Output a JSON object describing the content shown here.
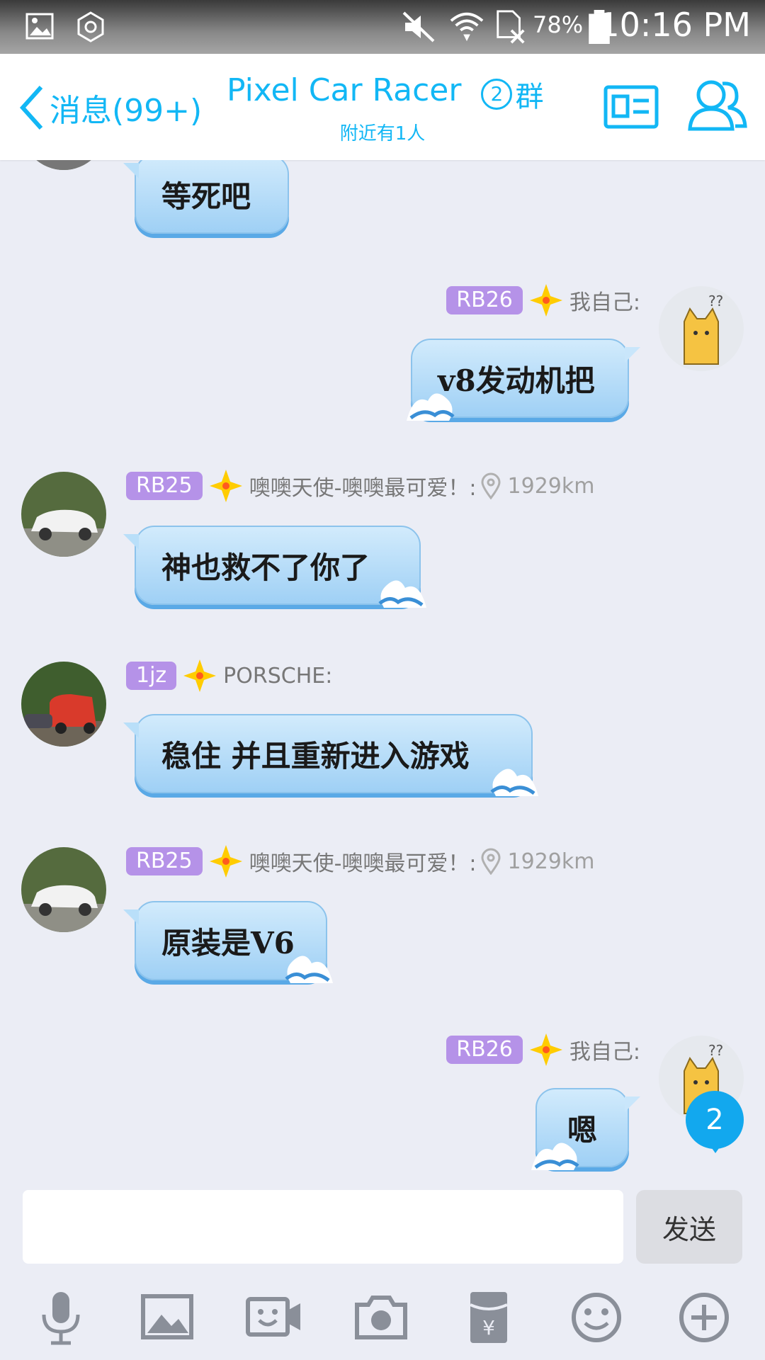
{
  "status_bar": {
    "battery_percent": "78%",
    "time": "10:16 PM"
  },
  "header": {
    "back_label": "消息(99+)",
    "title": "Pixel Car Racer",
    "group_number": "2",
    "group_suffix": "群",
    "subtitle": "附近有1人"
  },
  "messages": [
    {
      "side": "left",
      "text": "等死吧"
    },
    {
      "side": "right",
      "tag": "RB26",
      "sender": "我自己:",
      "text": "v8发动机把"
    },
    {
      "side": "left",
      "tag": "RB25",
      "sender": "噢噢天使-噢噢最可爱！:",
      "distance": "1929km",
      "text": "神也救不了你了"
    },
    {
      "side": "left",
      "tag": "1jz",
      "sender": "PORSCHE:",
      "text": "稳住 并且重新进入游戏"
    },
    {
      "side": "left",
      "tag": "RB25",
      "sender": "噢噢天使-噢噢最可爱！:",
      "distance": "1929km",
      "text": "原装是V6"
    },
    {
      "side": "right",
      "tag": "RB26",
      "sender": "我自己:",
      "text": "嗯"
    }
  ],
  "floating_badge": "2",
  "input": {
    "value": "",
    "send_label": "发送"
  },
  "toolbar_icons": [
    "microphone-icon",
    "image-icon",
    "video-call-icon",
    "camera-icon",
    "red-packet-icon",
    "emoji-icon",
    "plus-icon"
  ],
  "colors": {
    "accent": "#12b7f5",
    "tag": "#b592e8",
    "bubble": "#a9d6f7",
    "background": "#ebedf5"
  }
}
